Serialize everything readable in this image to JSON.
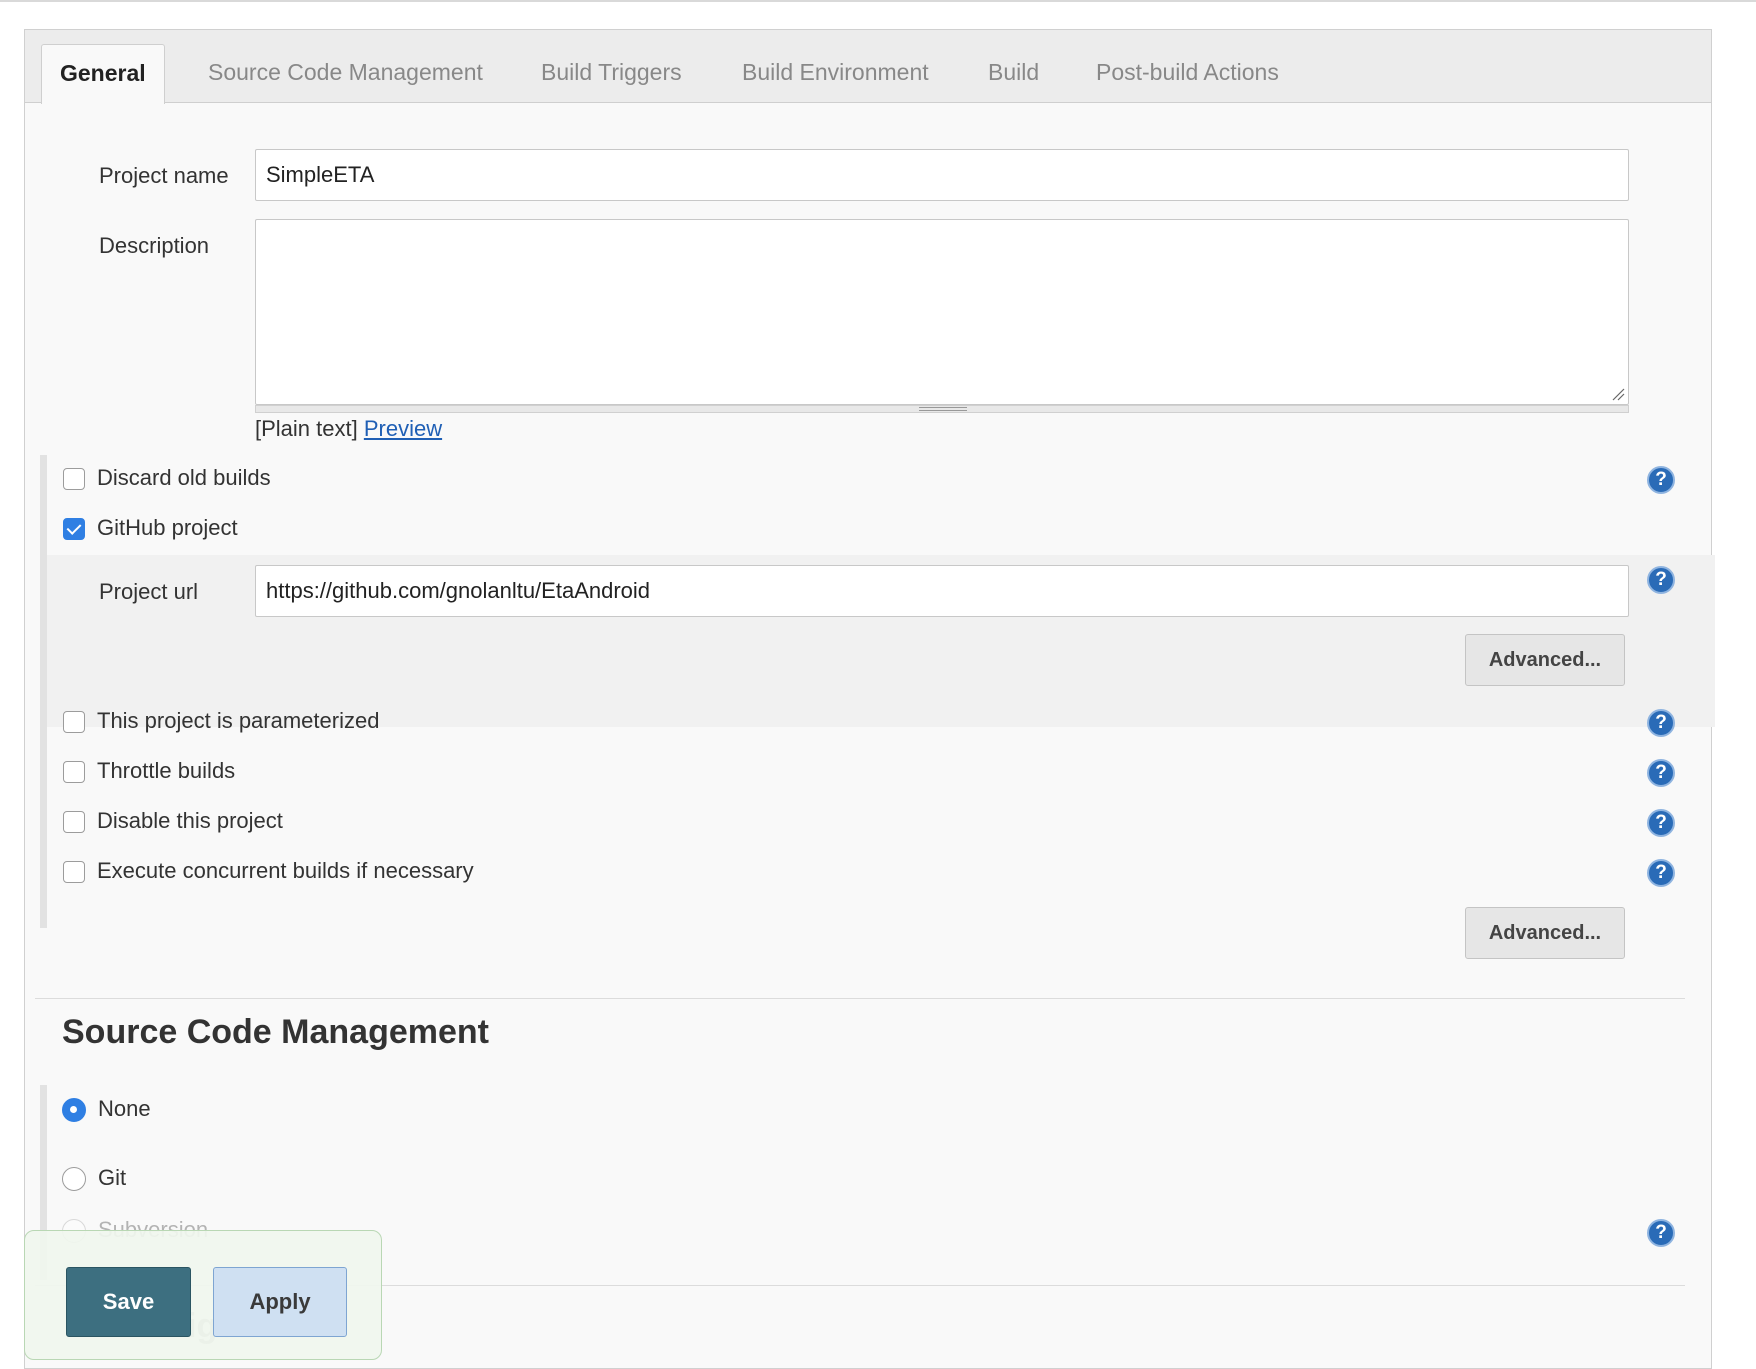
{
  "tabs": [
    {
      "label": "General",
      "active": true
    },
    {
      "label": "Source Code Management"
    },
    {
      "label": "Build Triggers"
    },
    {
      "label": "Build Environment"
    },
    {
      "label": "Build"
    },
    {
      "label": "Post-build Actions"
    }
  ],
  "general": {
    "project_name_label": "Project name",
    "project_name_value": "SimpleETA",
    "description_label": "Description",
    "description_value": "",
    "plain_text_label": "[Plain text]",
    "preview_link": "Preview"
  },
  "options": [
    {
      "label": "Discard old builds",
      "checked": false
    },
    {
      "label": "GitHub project",
      "checked": true
    },
    {
      "label": "This project is parameterized",
      "checked": false
    },
    {
      "label": "Throttle builds",
      "checked": false
    },
    {
      "label": "Disable this project",
      "checked": false
    },
    {
      "label": "Execute concurrent builds if necessary",
      "checked": false
    }
  ],
  "github": {
    "project_url_label": "Project url",
    "project_url_value": "https://github.com/gnolanltu/EtaAndroid",
    "advanced_label": "Advanced..."
  },
  "advanced_label": "Advanced...",
  "help_icon_glyph": "?",
  "scm": {
    "heading": "Source Code Management",
    "options": [
      {
        "label": "None",
        "selected": true
      },
      {
        "label": "Git",
        "selected": false
      },
      {
        "label": "Subversion",
        "selected": false
      }
    ]
  },
  "next_heading_partial": "ige",
  "actions": {
    "save_label": "Save",
    "apply_label": "Apply"
  },
  "colors": {
    "accent": "#2f7fe3",
    "help": "#2a6bb7",
    "save_bg": "#3d6f80",
    "apply_bg": "#cfe0f2",
    "link": "#1f5fb5"
  }
}
